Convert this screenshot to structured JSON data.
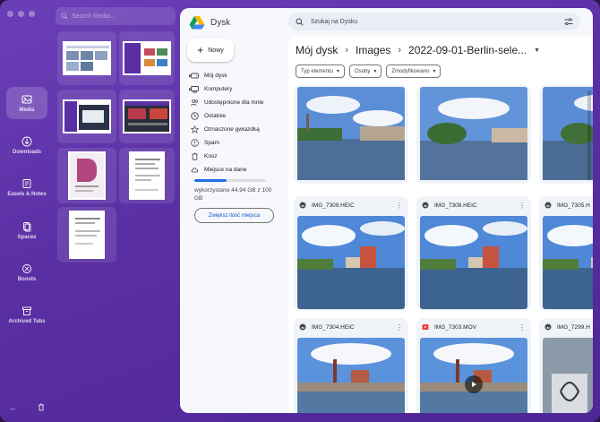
{
  "rail": {
    "items": [
      {
        "label": "Media",
        "icon": "media-icon"
      },
      {
        "label": "Downloads",
        "icon": "download-icon"
      },
      {
        "label": "Easels & Notes",
        "icon": "easel-icon"
      },
      {
        "label": "Spaces",
        "icon": "spaces-icon"
      },
      {
        "label": "Boosts",
        "icon": "boosts-icon"
      },
      {
        "label": "Archived Tabs",
        "icon": "archive-icon"
      }
    ]
  },
  "media_panel": {
    "search_placeholder": "Search Media..."
  },
  "drive": {
    "app_name": "Dysk",
    "new_label": "Nowy",
    "nav": [
      {
        "label": "Mój dysk",
        "icon": "drive-icon",
        "caret": true
      },
      {
        "label": "Komputery",
        "icon": "computer-icon",
        "caret": true
      },
      {
        "label": "Udostępnione dla mnie",
        "icon": "shared-icon",
        "caret": false
      },
      {
        "label": "Ostatnie",
        "icon": "clock-icon",
        "caret": false
      },
      {
        "label": "Oznaczone gwiazdką",
        "icon": "star-icon",
        "caret": false
      },
      {
        "label": "Spam",
        "icon": "spam-icon",
        "caret": false
      },
      {
        "label": "Kosz",
        "icon": "trash-icon",
        "caret": false
      },
      {
        "label": "Miejsce na dane",
        "icon": "cloud-icon",
        "caret": false
      }
    ],
    "storage": {
      "used_fraction": 0.45,
      "text": "wykorzystano 44,94 GB z 100 GB",
      "button": "Zwiększ ilość miejsca"
    },
    "search_placeholder": "Szukaj na Dysku",
    "breadcrumb": [
      "Mój dysk",
      "Images",
      "2022-09-01-Berlin-sele..."
    ],
    "filters": [
      "Typ elementu",
      "Osoby",
      "Zmodyfikowano"
    ],
    "files": [
      {
        "name": "",
        "type": "image"
      },
      {
        "name": "",
        "type": "image"
      },
      {
        "name": "",
        "type": "image"
      },
      {
        "name": "IMG_7309.HEIC",
        "type": "image"
      },
      {
        "name": "IMG_7308.HEIC",
        "type": "image"
      },
      {
        "name": "IMG_7305.H",
        "type": "image"
      },
      {
        "name": "IMG_7304.HEIC",
        "type": "image"
      },
      {
        "name": "IMG_7303.MOV",
        "type": "video"
      },
      {
        "name": "IMG_7299.H",
        "type": "image"
      }
    ]
  },
  "colors": {
    "accent": "#1a73e8",
    "purple": "#5a2fa3",
    "video": "#ea4335"
  }
}
